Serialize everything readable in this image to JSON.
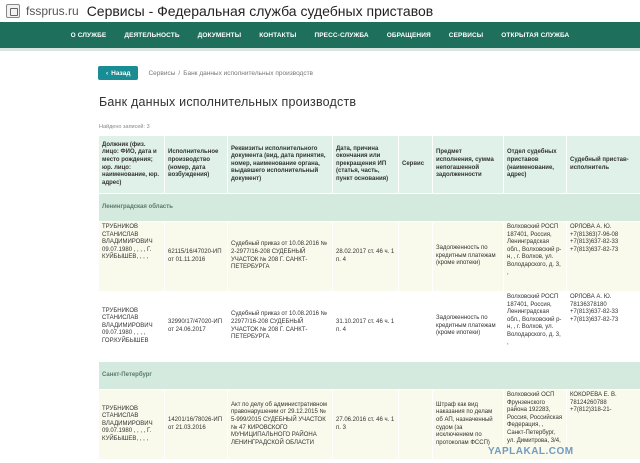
{
  "window": {
    "domain": "fssprus.ru",
    "title": "Сервисы - Федеральная служба судебных приставов"
  },
  "nav": {
    "items": [
      "О СЛУЖБЕ",
      "ДЕЯТЕЛЬНОСТЬ",
      "ДОКУМЕНТЫ",
      "КОНТАКТЫ",
      "ПРЕСС-СЛУЖБА",
      "ОБРАЩЕНИЯ",
      "СЕРВИСЫ",
      "ОТКРЫТАЯ СЛУЖБА"
    ]
  },
  "breadcrumb": {
    "back_label": "Назад",
    "items": [
      "Сервисы",
      "Банк данных исполнительных производств"
    ]
  },
  "page": {
    "title": "Банк данных исполнительных производств",
    "found": "Найдено записей: 3"
  },
  "table": {
    "headers": [
      "Должник (физ. лицо: ФИО, дата и место рождения; юр. лицо: наименование, юр. адрес)",
      "Исполнительное производство (номер, дата возбуждения)",
      "Реквизиты исполнительного документа (вид, дата принятия, номер, наименование органа, выдавшего исполнительный документ)",
      "Дата, причина окончания или прекращения ИП (статья, часть, пункт основания)",
      "Сервис",
      "Предмет исполнения, сумма непогашенной задолженности",
      "Отдел судебных приставов (наименование, адрес)",
      "Судебный пристав-исполнитель"
    ],
    "regions": [
      "Ленинградская область",
      "Санкт-Петербург"
    ],
    "rows": [
      {
        "debtor": "ТРУБНИКОВ СТАНИСЛАВ ВЛАДИМИРОВИЧ 09.07.1980 , , , , Г. КУЙБЫШЕВ, , , ,",
        "ip": "62115/16/47020-ИП от 01.11.2016",
        "doc": "Судебный приказ от 10.08.2016 № 2-2977/16-208 СУДЕБНЫЙ УЧАСТОК № 208 Г. САНКТ-ПЕТЕРБУРГА",
        "end": "28.02.2017 ст. 46 ч. 1 п. 4",
        "service": "",
        "subject": "Задолженность по кредитным платежам (кроме ипотеки)",
        "osp": "Волховский РОСП 187401, Россия, Ленинградская обл., Волховский р-н, , г. Волхов, ул. Володарского, д. 3, ,",
        "bailiff": "ОРЛОВА А. Ю. +7(81363)7-96-08 +7(813)637-82-33 +7(813)637-82-73"
      },
      {
        "debtor": "ТРУБНИКОВ СТАНИСЛАВ ВЛАДИМИРОВИЧ 09.07.1980 , , , , ГОР.КУЙБЫШЕВ",
        "ip": "32990/17/47020-ИП от 24.06.2017",
        "doc": "Судебный приказ от 10.08.2016 № 22977/16-208 СУДЕБНЫЙ УЧАСТОК № 208 Г. САНКТ-ПЕТЕРБУРГА",
        "end": "31.10.2017 ст. 46 ч. 1 п. 4",
        "service": "",
        "subject": "Задолженность по кредитным платежам (кроме ипотеки)",
        "osp": "Волховский РОСП 187401, Россия, Ленинградская обл., Волховский р-н, , г. Волхов, ул. Володарского, д. 3, ,",
        "bailiff": "ОРЛОВА А. Ю. 78136378180 +7(813)637-82-33 +7(813)637-82-73"
      },
      {
        "debtor": "ТРУБНИКОВ СТАНИСЛАВ ВЛАДИМИРОВИЧ 09.07.1980 , , , , Г. КУЙБЫШЕВ, , , ,",
        "ip": "14201/16/78026-ИП от 21.03.2016",
        "doc": "Акт по делу об административном правонарушении от 29.12.2015 № 5-999/2015 СУДЕБНЫЙ УЧАСТОК № 47 КИРОВСКОГО МУНИЦИПАЛЬНОГО РАЙОНА ЛЕНИНГРАДСКОЙ ОБЛАСТИ",
        "end": "27.06.2016 ст. 46 ч. 1 п. 3",
        "service": "",
        "subject": "Штраф как вид наказания по делам об АП, назначенный судом (за исключением по протоколам ФССП)",
        "osp": "Волховский ОСП Фрунзенского района 192283, Россия, Российская Федерация, , Санкт-Петербург, ул. Димитрова, 3/4,",
        "bailiff": "КОКОРЕВА Е. В. 78124260788 +7(812)318-21-"
      }
    ]
  },
  "watermark": "YAPLAKAL.COM"
}
